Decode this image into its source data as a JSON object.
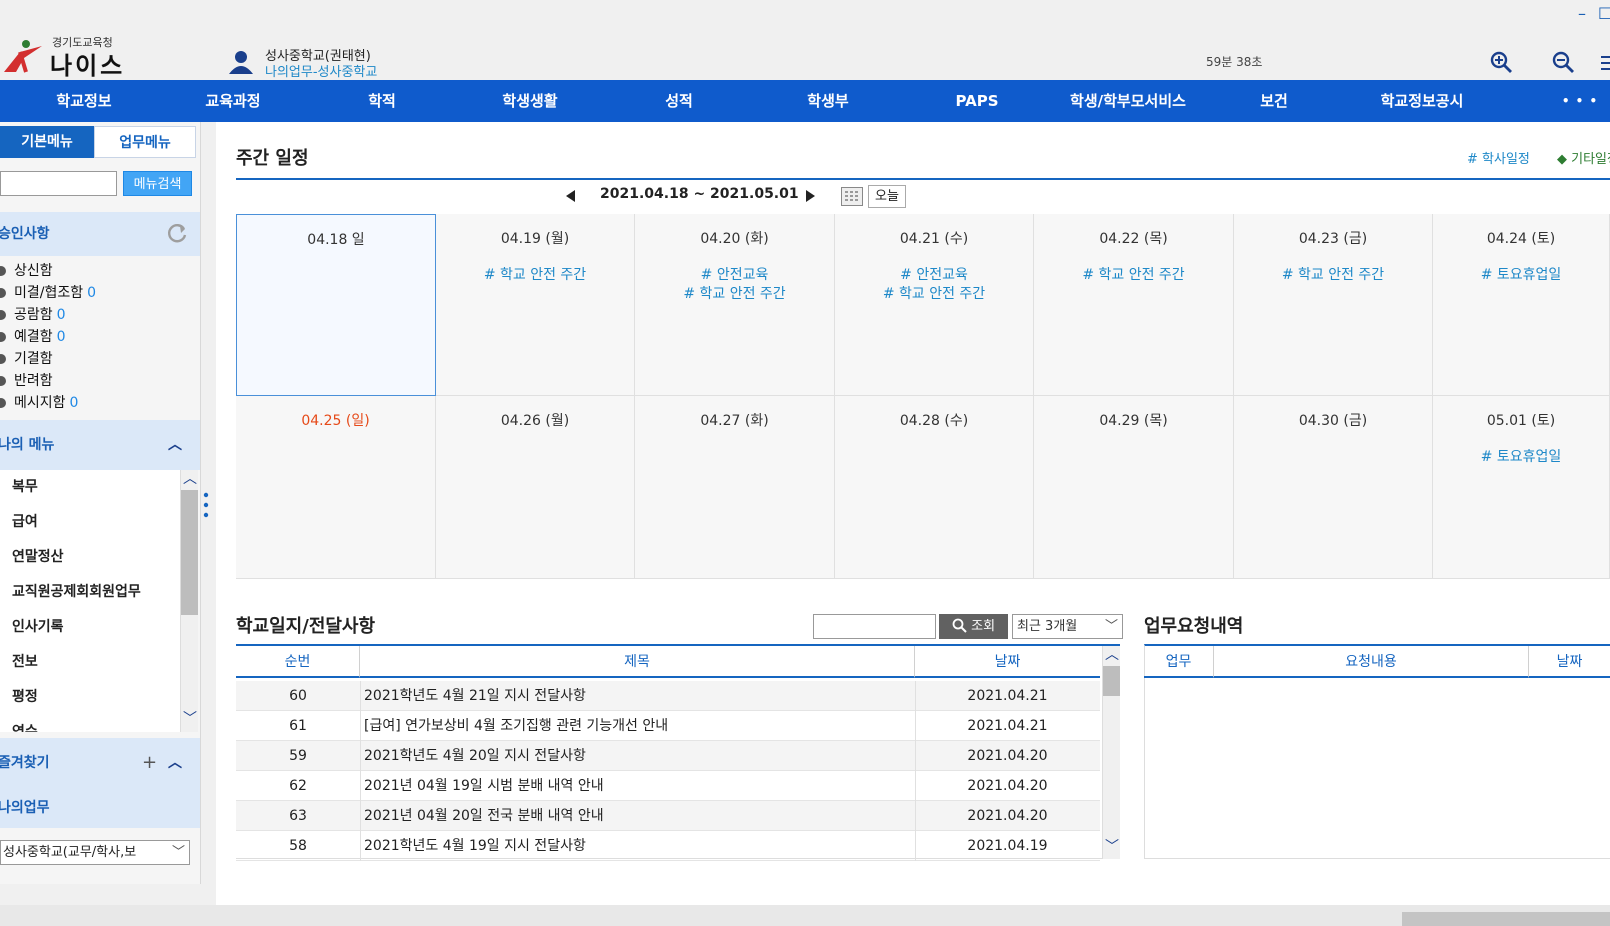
{
  "window": {
    "minimize": "–",
    "maximize": "☐"
  },
  "header": {
    "org_subtitle": "경기도교육청",
    "app_name": "나이스",
    "user_name": "성사중학교(권태현)",
    "user_dept": "나의업무-성사중학교",
    "session_timer": "59분 38초"
  },
  "nav": {
    "items": [
      "학교정보",
      "교육과정",
      "학적",
      "학생생활",
      "성적",
      "학생부",
      "PAPS",
      "학생/학부모서비스",
      "보건",
      "학교정보공시"
    ],
    "more": "• • •"
  },
  "sidebar": {
    "tabs": [
      "기본메뉴",
      "업무메뉴"
    ],
    "search_button": "메뉴검색",
    "approval_title": "승인사항",
    "approval_items": [
      {
        "label": "상신함",
        "count": ""
      },
      {
        "label": "미결/협조함",
        "count": "0"
      },
      {
        "label": "공람함",
        "count": "0"
      },
      {
        "label": "예결함",
        "count": "0"
      },
      {
        "label": "기결함",
        "count": ""
      },
      {
        "label": "반려함",
        "count": ""
      },
      {
        "label": "메시지함",
        "count": "0"
      }
    ],
    "my_menu_title": "나의 메뉴",
    "my_menu_items": [
      "복무",
      "급여",
      "연말정산",
      "교직원공제회회원업무",
      "인사기록",
      "전보",
      "평정",
      "연수"
    ],
    "favorites_title": "즐겨찾기",
    "my_work_title": "나의업무",
    "school_select": "성사중학교(교무/학사,보"
  },
  "weekly": {
    "title": "주간 일정",
    "legend_academic": "# 학사일정",
    "legend_other": "◆ 기타일정",
    "range": "2021.04.18 ~ 2021.05.01",
    "today_button": "오늘",
    "weeks": [
      [
        {
          "date": "04.18 일",
          "events": [],
          "today": true
        },
        {
          "date": "04.19 (월)",
          "events": [
            "# 학교 안전 주간"
          ]
        },
        {
          "date": "04.20 (화)",
          "events": [
            "# 안전교육",
            "# 학교 안전 주간"
          ]
        },
        {
          "date": "04.21 (수)",
          "events": [
            "# 안전교육",
            "# 학교 안전 주간"
          ]
        },
        {
          "date": "04.22 (목)",
          "events": [
            "# 학교 안전 주간"
          ]
        },
        {
          "date": "04.23 (금)",
          "events": [
            "# 학교 안전 주간"
          ]
        },
        {
          "date": "04.24 (토)",
          "events": [
            "# 토요휴업일"
          ]
        }
      ],
      [
        {
          "date": "04.25 (일)",
          "events": [],
          "red": true
        },
        {
          "date": "04.26 (월)",
          "events": []
        },
        {
          "date": "04.27 (화)",
          "events": []
        },
        {
          "date": "04.28 (수)",
          "events": []
        },
        {
          "date": "04.29 (목)",
          "events": []
        },
        {
          "date": "04.30 (금)",
          "events": []
        },
        {
          "date": "05.01 (토)",
          "events": [
            "# 토요휴업일"
          ]
        }
      ]
    ]
  },
  "notices": {
    "title": "학교일지/전달사항",
    "search_button": "조회",
    "period_select": "최근 3개월",
    "columns": [
      "순번",
      "제목",
      "날짜"
    ],
    "rows": [
      {
        "no": "60",
        "title": "2021학년도 4월 21일 지시 전달사항",
        "date": "2021.04.21"
      },
      {
        "no": "61",
        "title": "[급여] 연가보상비 4월 조기집행 관련 기능개선 안내",
        "date": "2021.04.21"
      },
      {
        "no": "59",
        "title": "2021학년도 4월 20일 지시 전달사항",
        "date": "2021.04.20"
      },
      {
        "no": "62",
        "title": "2021년 04월 19일 시범 분배 내역 안내",
        "date": "2021.04.20"
      },
      {
        "no": "63",
        "title": "2021년 04월 20일 전국 분배 내역 안내",
        "date": "2021.04.20"
      },
      {
        "no": "58",
        "title": "2021학년도 4월 19일 지시 전달사항",
        "date": "2021.04.19"
      }
    ]
  },
  "requests": {
    "title": "업무요청내역",
    "columns": [
      "업무",
      "요청내용",
      "날짜"
    ]
  },
  "colors": {
    "nav_blue": "#0f5bcc",
    "accent": "#1565c0",
    "event": "#1e88c8",
    "sunday": "#e64a19"
  }
}
